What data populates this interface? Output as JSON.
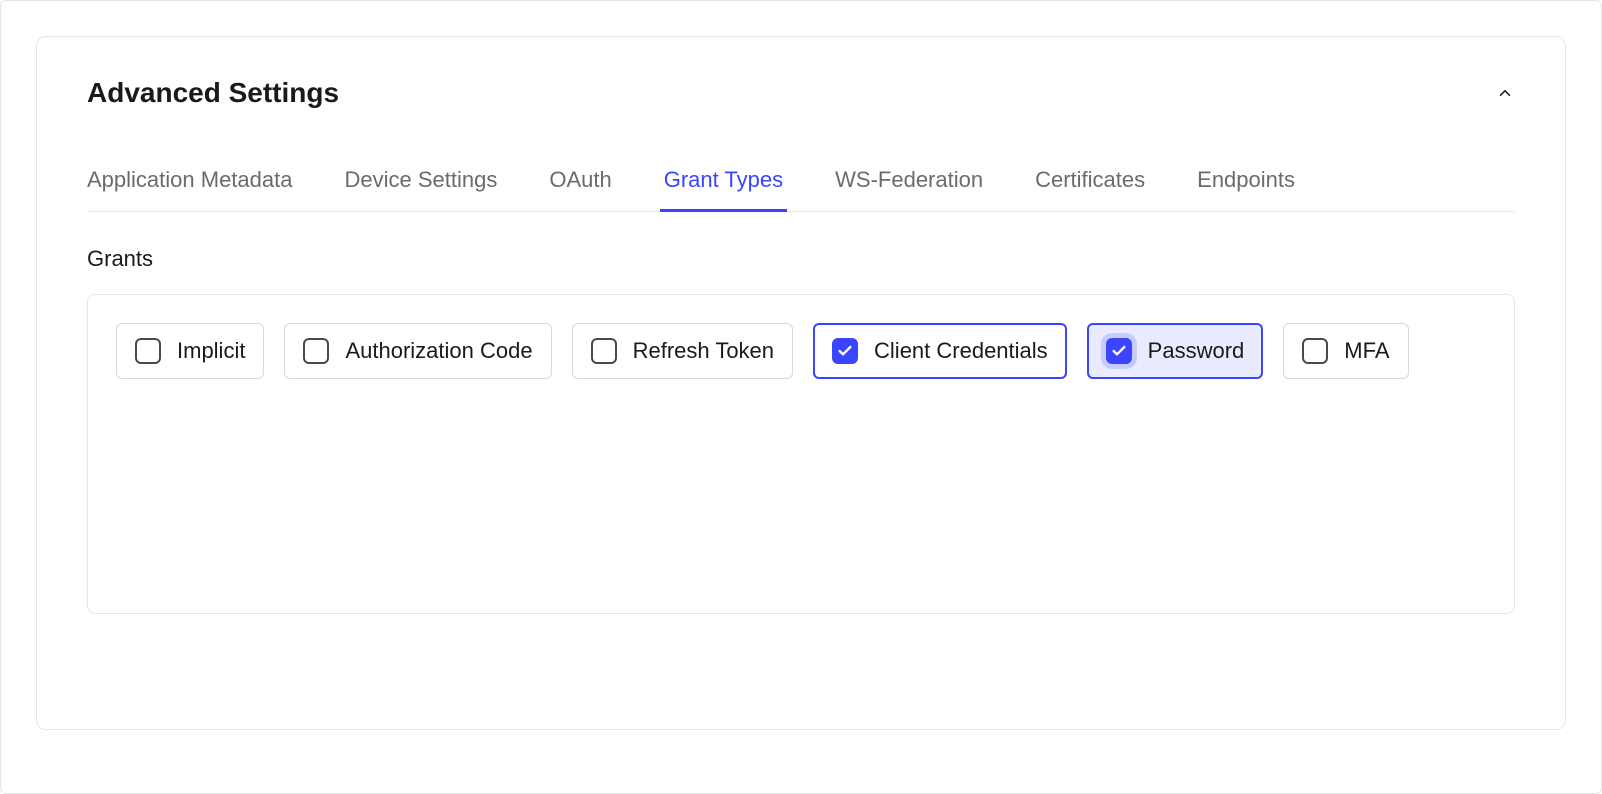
{
  "header": {
    "title": "Advanced Settings"
  },
  "tabs": [
    {
      "label": "Application Metadata",
      "active": false
    },
    {
      "label": "Device Settings",
      "active": false
    },
    {
      "label": "OAuth",
      "active": false
    },
    {
      "label": "Grant Types",
      "active": true
    },
    {
      "label": "WS-Federation",
      "active": false
    },
    {
      "label": "Certificates",
      "active": false
    },
    {
      "label": "Endpoints",
      "active": false
    }
  ],
  "section": {
    "label": "Grants"
  },
  "grants": [
    {
      "label": "Implicit",
      "checked": false,
      "focus": false
    },
    {
      "label": "Authorization Code",
      "checked": false,
      "focus": false
    },
    {
      "label": "Refresh Token",
      "checked": false,
      "focus": false
    },
    {
      "label": "Client Credentials",
      "checked": true,
      "focus": false
    },
    {
      "label": "Password",
      "checked": true,
      "focus": true
    },
    {
      "label": "MFA",
      "checked": false,
      "focus": false
    }
  ],
  "colors": {
    "accent": "#3b45ff",
    "border": "#e6e6e6",
    "textMuted": "#6b6b6b"
  }
}
